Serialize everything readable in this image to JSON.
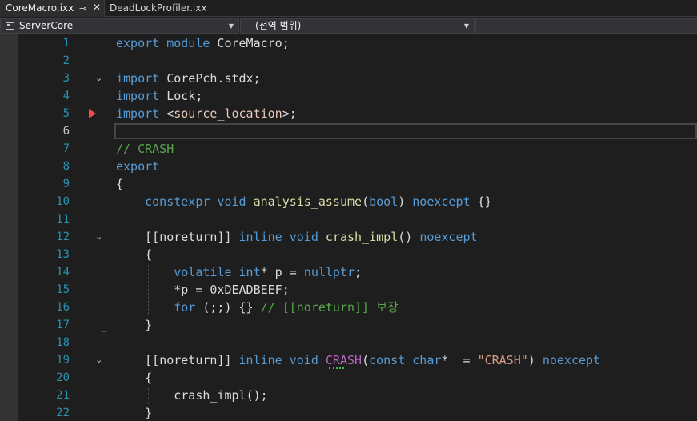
{
  "tabs": [
    {
      "label": "CoreMacro.ixx",
      "pin_icon": "pin-icon",
      "close_icon": "close-icon"
    },
    {
      "label": "DeadLockProfiler.ixx"
    }
  ],
  "nav": {
    "project": "ServerCore",
    "scope": "(전역 범위)"
  },
  "lines": [
    {
      "num": "1"
    },
    {
      "num": "2"
    },
    {
      "num": "3"
    },
    {
      "num": "4"
    },
    {
      "num": "5"
    },
    {
      "num": "6"
    },
    {
      "num": "7"
    },
    {
      "num": "8"
    },
    {
      "num": "9"
    },
    {
      "num": "10"
    },
    {
      "num": "11"
    },
    {
      "num": "12"
    },
    {
      "num": "13"
    },
    {
      "num": "14"
    },
    {
      "num": "15"
    },
    {
      "num": "16"
    },
    {
      "num": "17"
    },
    {
      "num": "18"
    },
    {
      "num": "19"
    },
    {
      "num": "20"
    },
    {
      "num": "21"
    },
    {
      "num": "22"
    }
  ],
  "code": {
    "l1": {
      "kw1": "export",
      "kw2": "module",
      "rest": " CoreMacro;"
    },
    "l3": {
      "kw": "import",
      "rest": " CorePch.stdx;"
    },
    "l4": {
      "kw": "import",
      "rest": " Lock;"
    },
    "l5": {
      "kw": "import",
      "lt": " <",
      "inc": "source_location",
      "gt": ">;"
    },
    "l7": {
      "comment": "// CRASH"
    },
    "l8": {
      "kw": "export"
    },
    "l9": {
      "text": "{"
    },
    "l10": {
      "indent": "    ",
      "kw1": "constexpr",
      "kw2": "void",
      "fn": "analysis_assume",
      "p1": "(",
      "kw3": "bool",
      "p2": ")",
      "kw4": "noexcept",
      "end": " {}"
    },
    "l12": {
      "indent": "    ",
      "a1": "[[",
      "attr": "noreturn",
      "a2": "]] ",
      "kw1": "inline",
      "kw2": "void",
      "fn": "crash_impl",
      "p": "() ",
      "kw3": "noexcept"
    },
    "l13": {
      "text": "    {"
    },
    "l14": {
      "indent": "        ",
      "kw1": "volatile",
      "kw2": "int",
      "mid": "* p = ",
      "kw3": "nullptr",
      "end": ";"
    },
    "l15": {
      "text": "        *p = 0xDEADBEEF;"
    },
    "l16": {
      "indent": "        ",
      "kw": "for",
      "mid": " (;;) {} ",
      "comment": "// [[noreturn]] 보장"
    },
    "l17": {
      "text": "    }"
    },
    "l19": {
      "indent": "    ",
      "a1": "[[",
      "attr": "noreturn",
      "a2": "]] ",
      "kw1": "inline",
      "kw2": "void",
      "mac": "CRASH",
      "p1": "(",
      "kw3": "const",
      "kw4": "char",
      "mid": "*  = ",
      "str": "\"CRASH\"",
      "p2": ") ",
      "kw5": "noexcept"
    },
    "l20": {
      "text": "    {"
    },
    "l21": {
      "indent": "        ",
      "fn": "crash_impl",
      "end": "();"
    },
    "l22": {
      "text": "    }"
    }
  },
  "icons": {
    "fold": "chevron-down-icon",
    "breakpoint": "breakpoint-arrow-icon",
    "combo_dropdown": "dropdown-arrow-icon"
  },
  "colors": {
    "keyword": "#569cd6",
    "comment": "#57a64a",
    "string": "#d69d85",
    "function": "#dcdcaa",
    "macro": "#bd63c5",
    "line_number": "#2b91af",
    "breakpoint": "#f14c4c",
    "background": "#1e1e1e"
  }
}
